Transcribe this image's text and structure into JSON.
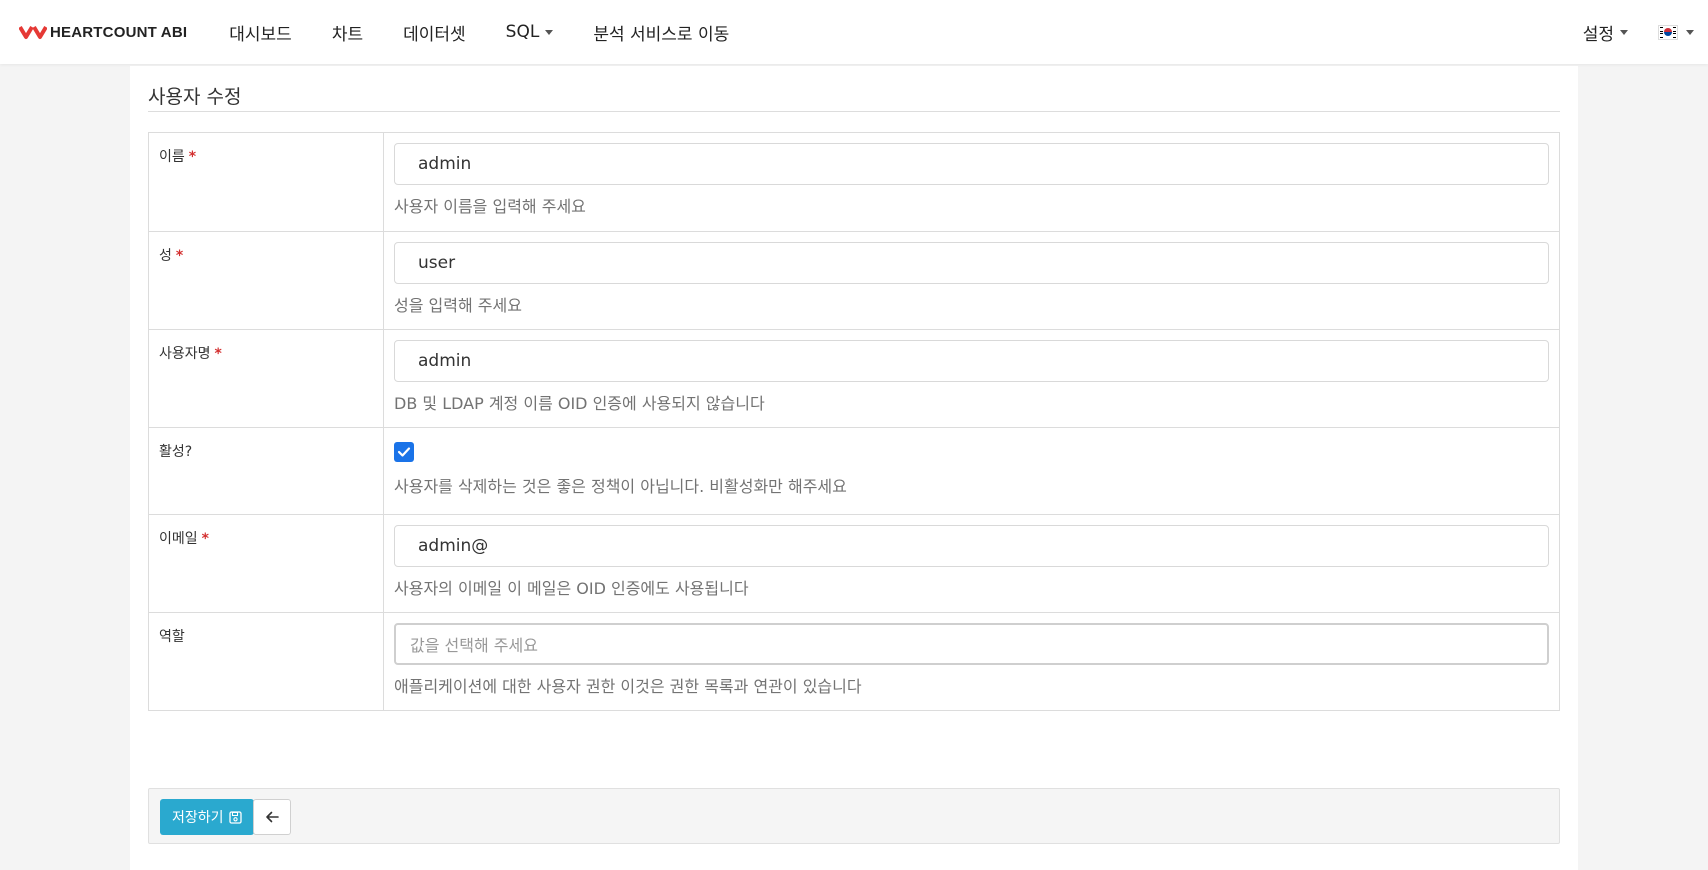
{
  "brand": {
    "name": "HEARTCOUNT ABI",
    "logo_color": "#e53935"
  },
  "nav": {
    "items": [
      {
        "label": "대시보드",
        "dropdown": false
      },
      {
        "label": "차트",
        "dropdown": false
      },
      {
        "label": "데이터셋",
        "dropdown": false
      },
      {
        "label": "SQL",
        "dropdown": true
      },
      {
        "label": "분석 서비스로 이동",
        "dropdown": false
      }
    ],
    "settings_label": "설정",
    "language_icon": "kr-flag-icon"
  },
  "page": {
    "title": "사용자 수정"
  },
  "form": {
    "first_name": {
      "label": "이름",
      "required": true,
      "value": "admin",
      "help": "사용자 이름을 입력해 주세요"
    },
    "last_name": {
      "label": "성",
      "required": true,
      "value": "user",
      "help": "성을 입력해 주세요"
    },
    "username": {
      "label": "사용자명",
      "required": true,
      "value": "admin",
      "help": "DB 및 LDAP 계정 이름 OID 인증에 사용되지 않습니다"
    },
    "active": {
      "label": "활성?",
      "checked": true,
      "help": "사용자를 삭제하는 것은 좋은 정책이 아닙니다. 비활성화만 해주세요"
    },
    "email": {
      "label": "이메일",
      "required": true,
      "value": "admin@",
      "help": "사용자의 이메일 이 메일은 OID 인증에도 사용됩니다"
    },
    "role": {
      "label": "역할",
      "placeholder": "값을 선택해 주세요",
      "help": "애플리케이션에 대한 사용자 권한 이것은 권한 목록과 연관이 있습니다"
    }
  },
  "actions": {
    "save_label": "저장하기",
    "save_color": "#2aa9cf",
    "back_icon": "arrow-left-icon"
  },
  "required_marker": "*",
  "colors": {
    "checkbox": "#1a73e8",
    "required": "#d32f2f"
  }
}
